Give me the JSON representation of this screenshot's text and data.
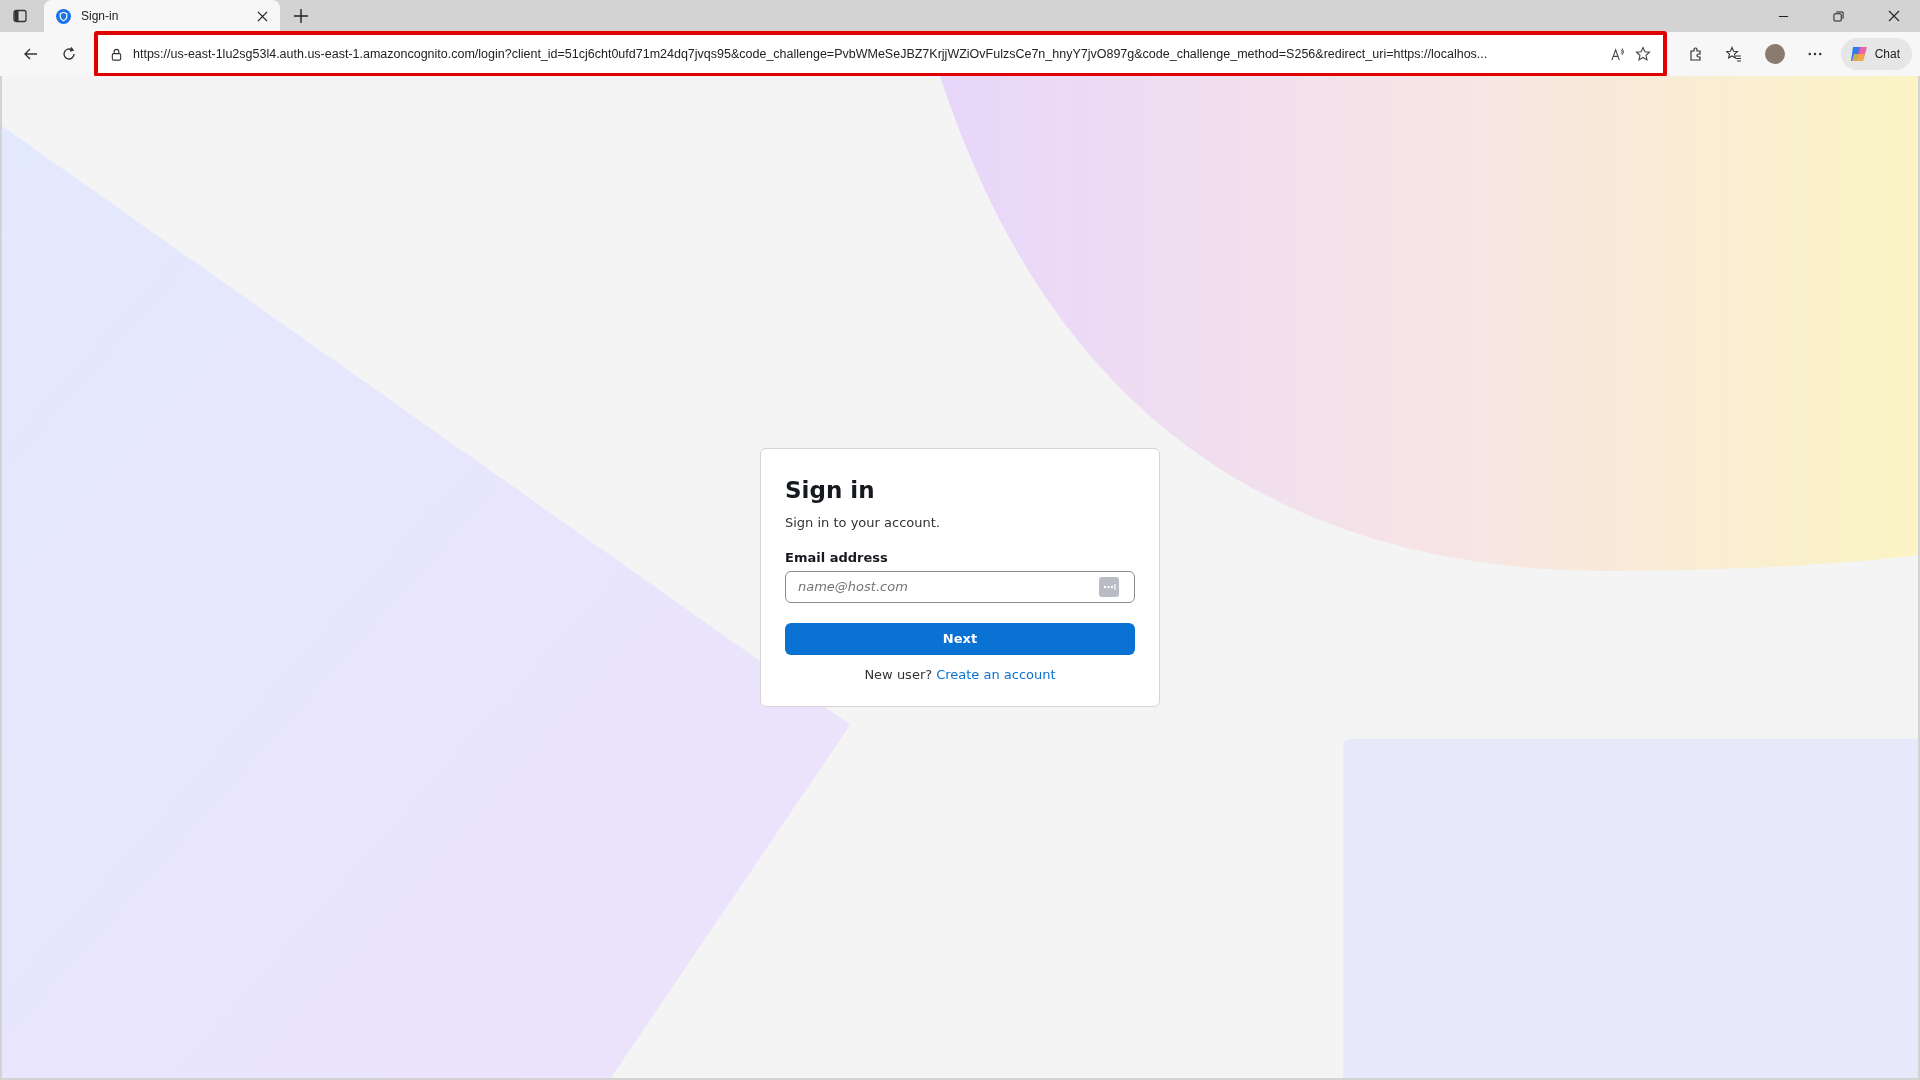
{
  "browser": {
    "tab": {
      "title": "Sign-in",
      "selected": true
    },
    "address": {
      "url": "https://us-east-1lu2sg53l4.auth.us-east-1.amazoncognito.com/login?client_id=51cj6cht0ufd71m24dq7jvqs95&code_challenge=PvbWMeSeJBZ7KrjjWZiOvFulzsCe7n_hnyY7jvO897g&code_challenge_method=S256&redirect_uri=https://localhos...",
      "highlighted": true
    },
    "chat_button": {
      "label": "Chat"
    }
  },
  "card": {
    "title": "Sign in",
    "subtitle": "Sign in to your account.",
    "email": {
      "label": "Email address",
      "placeholder": "name@host.com"
    },
    "next_button": {
      "label": "Next"
    },
    "signup": {
      "prompt": "New user?",
      "link": "Create an account"
    }
  }
}
